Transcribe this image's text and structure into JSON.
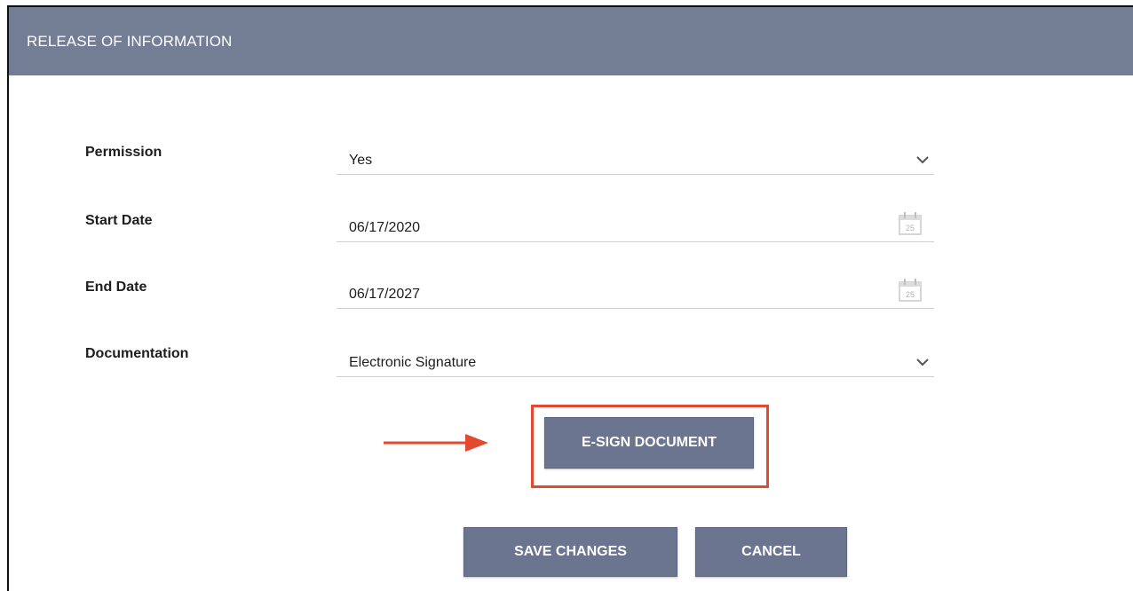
{
  "header": {
    "title": "RELEASE OF INFORMATION"
  },
  "form": {
    "permission": {
      "label": "Permission",
      "value": "Yes"
    },
    "start_date": {
      "label": "Start Date",
      "value": "06/17/2020"
    },
    "end_date": {
      "label": "End Date",
      "value": "06/17/2027"
    },
    "documentation": {
      "label": "Documentation",
      "value": "Electronic Signature"
    }
  },
  "calendar_icon_day": "25",
  "buttons": {
    "esign": "E-SIGN DOCUMENT",
    "save": "SAVE CHANGES",
    "cancel": "CANCEL"
  },
  "colors": {
    "header_bg": "#737d94",
    "button_bg": "#6c7590",
    "highlight": "#e2492e"
  }
}
